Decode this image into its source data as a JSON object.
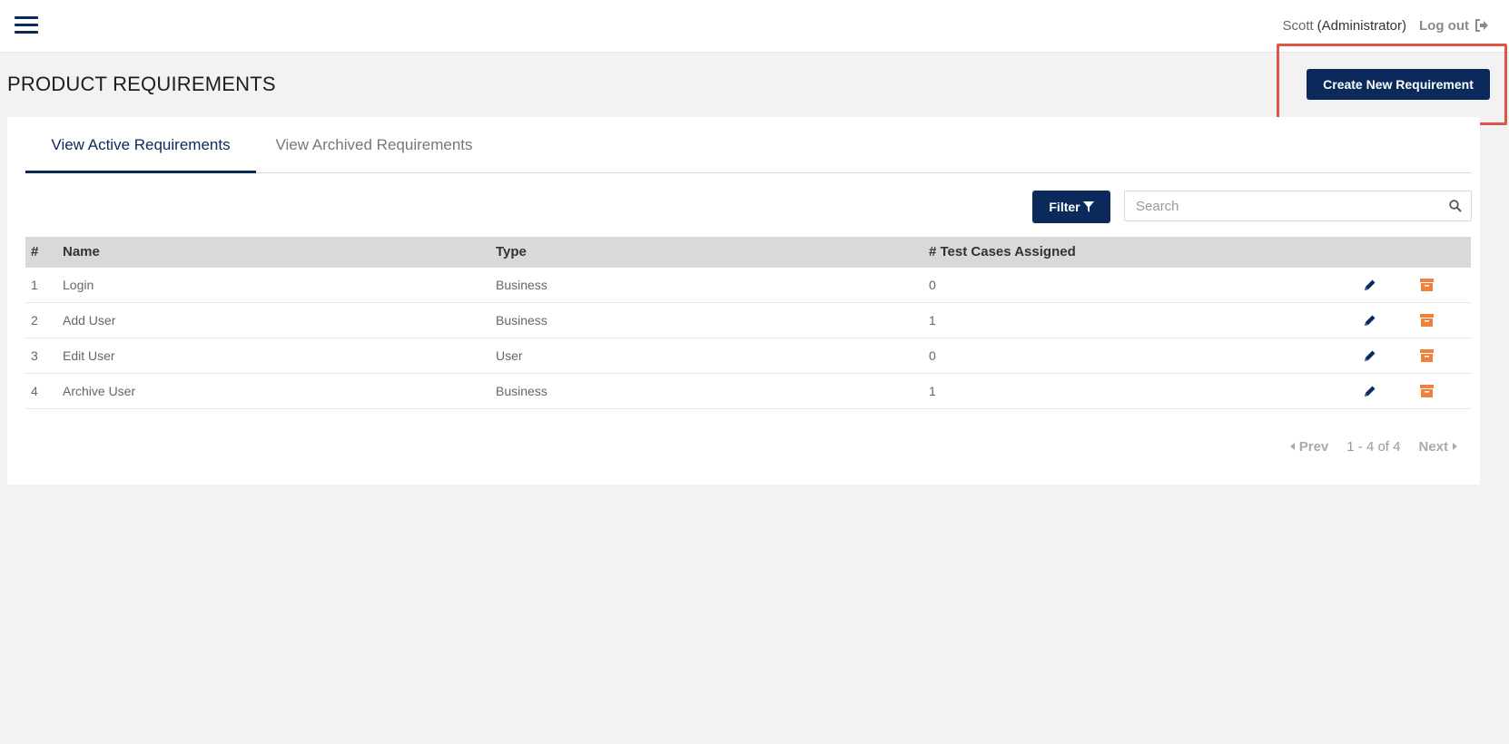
{
  "header": {
    "user_name": "Scott",
    "user_role": "(Administrator)",
    "logout_label": "Log out"
  },
  "page": {
    "title": "PRODUCT REQUIREMENTS",
    "create_button_label": "Create New Requirement"
  },
  "tabs": {
    "active_label": "View Active Requirements",
    "archived_label": "View Archived Requirements",
    "selected": "active"
  },
  "toolbar": {
    "filter_label": "Filter",
    "search_placeholder": "Search",
    "search_value": ""
  },
  "table": {
    "headers": [
      "#",
      "Name",
      "Type",
      "# Test Cases Assigned"
    ],
    "rows": [
      {
        "num": "1",
        "name": "Login",
        "type": "Business",
        "count": "0"
      },
      {
        "num": "2",
        "name": "Add User",
        "type": "Business",
        "count": "1"
      },
      {
        "num": "3",
        "name": "Edit User",
        "type": "User",
        "count": "0"
      },
      {
        "num": "4",
        "name": "Archive User",
        "type": "Business",
        "count": "1"
      }
    ]
  },
  "pagination": {
    "prev_label": "Prev",
    "info": "1 - 4 of 4",
    "next_label": "Next"
  },
  "icons": {
    "menu": "hamburger-icon",
    "logout": "sign-out-icon",
    "filter": "funnel-icon",
    "search": "search-icon",
    "edit": "pencil-icon",
    "archive": "archive-box-icon"
  },
  "colors": {
    "primary": "#0b2a5b",
    "archive": "#f0803c",
    "highlight": "#e0554a"
  }
}
